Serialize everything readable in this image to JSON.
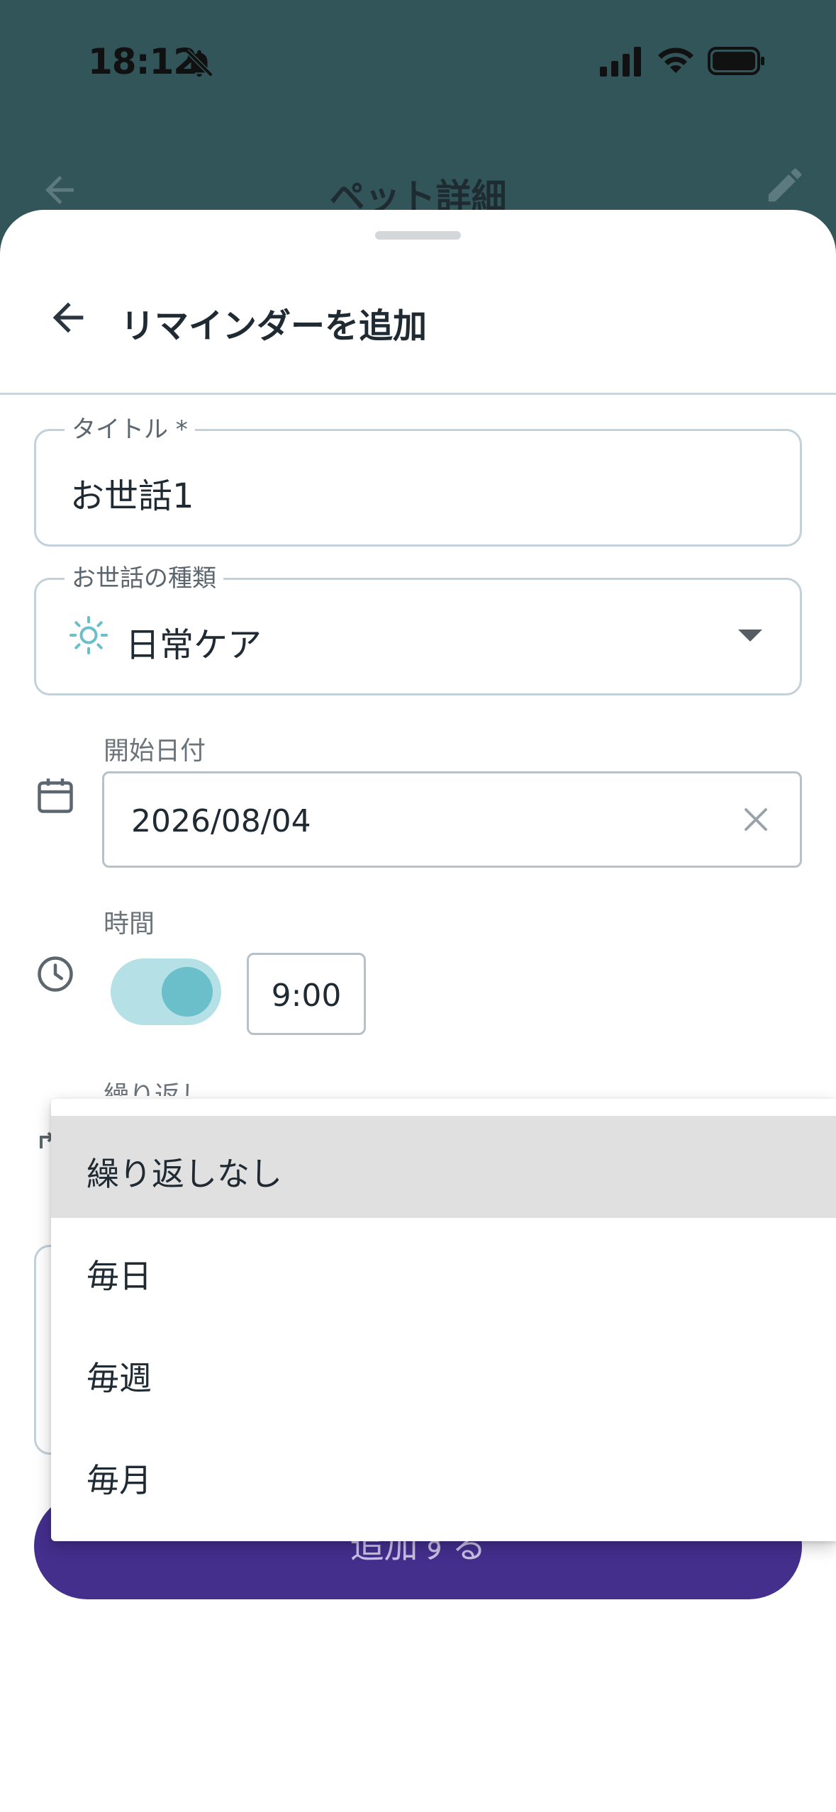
{
  "status_bar": {
    "time": "18:12"
  },
  "app_bar": {
    "title": "ペット詳細"
  },
  "sheet": {
    "title": "リマインダーを追加",
    "title_field": {
      "label": "タイトル *",
      "value": "お世話1"
    },
    "care_type_field": {
      "label": "お世話の種類",
      "value": "日常ケア",
      "icon": "sun-icon"
    },
    "start_date": {
      "label": "開始日付",
      "value": "2026/08/04"
    },
    "time": {
      "label": "時間",
      "enabled": true,
      "value": "9:00"
    },
    "repeat": {
      "label": "繰り返し"
    },
    "submit_label": "追加する"
  },
  "repeat_menu": {
    "selected_index": 0,
    "options": [
      "繰り返しなし",
      "毎日",
      "毎週",
      "毎月"
    ]
  },
  "colors": {
    "header_bg": "#32555a",
    "primary_button": "#442f8d",
    "toggle_track": "#b4e0e6",
    "toggle_knob": "#6abfca",
    "accent_icon": "#6abfca"
  }
}
